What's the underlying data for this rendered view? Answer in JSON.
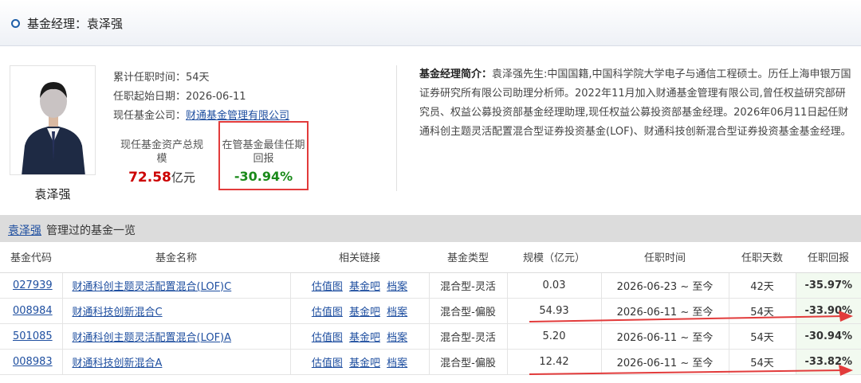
{
  "header": {
    "title": "基金经理：袁泽强"
  },
  "manager": {
    "name": "袁泽强",
    "tenure_label": "累计任职时间：",
    "tenure_value": "54天",
    "start_label": "任职起始日期：",
    "start_value": "2026-06-11",
    "company_label": "现任基金公司：",
    "company_value": "财通基金管理有限公司",
    "assets_label": "现任基金资产总规模",
    "assets_value": "72.58",
    "assets_unit": "亿元",
    "best_label": "在管基金最佳任期回报",
    "best_value": "-30.94%"
  },
  "bio": {
    "lead": "基金经理简介：",
    "text": "袁泽强先生:中国国籍,中国科学院大学电子与通信工程硕士。历任上海申银万国证券研究所有限公司助理分析师。2022年11月加入财通基金管理有限公司,曾任权益研究部研究员、权益公募投资部基金经理助理,现任权益公募投资部基金经理。2026年06月11日起任财通科创主题灵活配置混合型证券投资基金(LOF)、财通科技创新混合型证券投资基金基金经理。"
  },
  "list": {
    "manager": "袁泽强",
    "title_rest": "管理过的基金一览"
  },
  "table": {
    "headers": [
      "基金代码",
      "基金名称",
      "相关链接",
      "基金类型",
      "规模（亿元）",
      "任职时间",
      "任职天数",
      "任职回报"
    ],
    "link_labels": [
      "估值图",
      "基金吧",
      "档案"
    ],
    "rows": [
      {
        "code": "027939",
        "name": "财通科创主题灵活配置混合(LOF)C",
        "type": "混合型-灵活",
        "size": "0.03",
        "period": "2026-06-23 ~ 至今",
        "days": "42天",
        "return": "-35.97%"
      },
      {
        "code": "008984",
        "name": "财通科技创新混合C",
        "type": "混合型-偏股",
        "size": "54.93",
        "period": "2026-06-11 ~ 至今",
        "days": "54天",
        "return": "-33.90%"
      },
      {
        "code": "501085",
        "name": "财通科创主题灵活配置混合(LOF)A",
        "type": "混合型-灵活",
        "size": "5.20",
        "period": "2026-06-11 ~ 至今",
        "days": "54天",
        "return": "-30.94%"
      },
      {
        "code": "008983",
        "name": "财通科技创新混合A",
        "type": "混合型-偏股",
        "size": "12.42",
        "period": "2026-06-11 ~ 至今",
        "days": "54天",
        "return": "-33.82%"
      }
    ]
  },
  "colors": {
    "annotation_red": "#e23b3b",
    "return_green": "#1a8a1a",
    "asset_red": "#cc0000",
    "link_blue": "#1f4fa0"
  }
}
